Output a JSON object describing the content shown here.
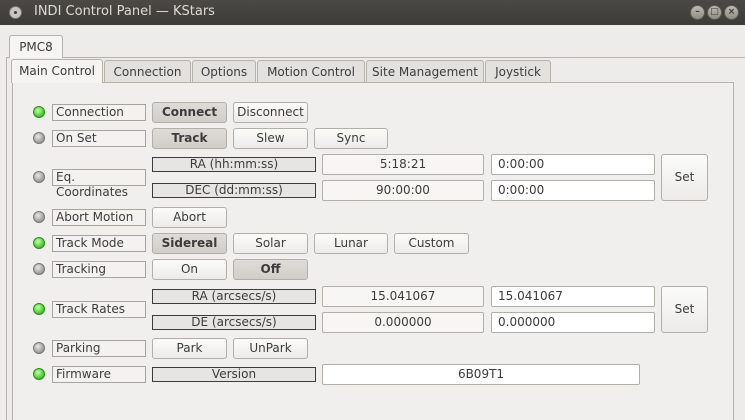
{
  "window": {
    "title": "INDI Control Panel — KStars"
  },
  "device_tabs": [
    "PMC8"
  ],
  "tabs": [
    "Main Control",
    "Connection",
    "Options",
    "Motion Control",
    "Site Management",
    "Joystick"
  ],
  "active_tab": "Main Control",
  "colors": {
    "led_on": "#58d33c",
    "led_idle": "#a9a9a9"
  },
  "properties": {
    "connection": {
      "label": "Connection",
      "state": "ok",
      "buttons": [
        "Connect",
        "Disconnect"
      ],
      "selected": "Connect"
    },
    "on_set": {
      "label": "On Set",
      "state": "idle",
      "buttons": [
        "Track",
        "Slew",
        "Sync"
      ],
      "selected": "Track"
    },
    "eq_coordinates": {
      "label": "Eq. Coordinates",
      "state": "idle",
      "rows": [
        {
          "label": "RA (hh:mm:ss)",
          "value": "5:18:21",
          "input": "0:00:00"
        },
        {
          "label": "DEC (dd:mm:ss)",
          "value": "90:00:00",
          "input": "0:00:00"
        }
      ],
      "set": "Set"
    },
    "abort_motion": {
      "label": "Abort Motion",
      "state": "idle",
      "buttons": [
        "Abort"
      ]
    },
    "track_mode": {
      "label": "Track Mode",
      "state": "ok",
      "buttons": [
        "Sidereal",
        "Solar",
        "Lunar",
        "Custom"
      ],
      "selected": "Sidereal"
    },
    "tracking": {
      "label": "Tracking",
      "state": "idle",
      "buttons": [
        "On",
        "Off"
      ],
      "selected": "Off"
    },
    "track_rates": {
      "label": "Track Rates",
      "state": "ok",
      "rows": [
        {
          "label": "RA (arcsecs/s)",
          "value": "15.041067",
          "input": "15.041067"
        },
        {
          "label": "DE (arcsecs/s)",
          "value": "0.000000",
          "input": "0.000000"
        }
      ],
      "set": "Set"
    },
    "parking": {
      "label": "Parking",
      "state": "idle",
      "buttons": [
        "Park",
        "UnPark"
      ]
    },
    "firmware": {
      "label": "Firmware",
      "state": "ok",
      "rows": [
        {
          "label": "Version",
          "value": "6B09T1"
        }
      ]
    }
  }
}
